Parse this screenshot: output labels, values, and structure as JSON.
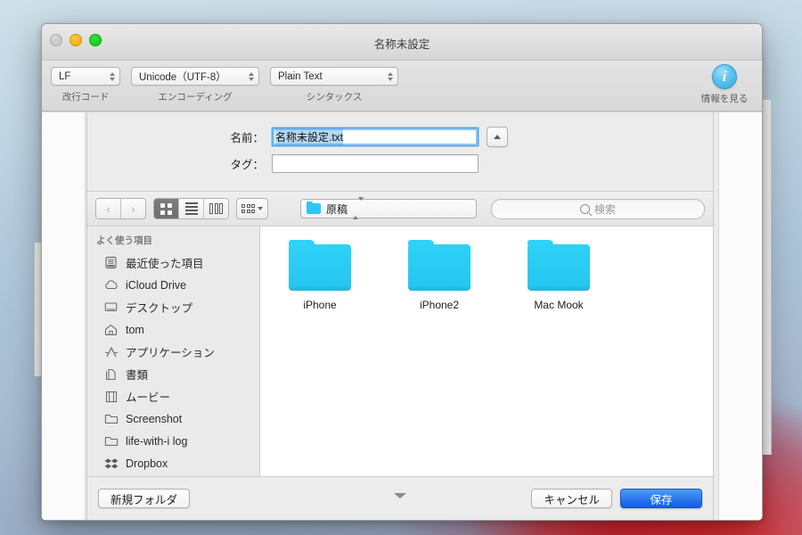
{
  "window": {
    "title": "名称未設定",
    "traffic_lights": [
      "close",
      "minimize",
      "zoom"
    ]
  },
  "toolbar": {
    "items": [
      {
        "value": "LF",
        "label": "改行コード",
        "name": "line-endings"
      },
      {
        "value": "Unicode（UTF-8）",
        "label": "エンコーディング",
        "name": "encoding"
      },
      {
        "value": "Plain Text",
        "label": "シンタックス",
        "name": "syntax"
      }
    ],
    "info_button": {
      "glyph": "i",
      "label": "情報を見る"
    }
  },
  "save_panel": {
    "name_label": "名前：",
    "name_value": "名称未設定.txt",
    "tag_label": "タグ：",
    "tag_value": "",
    "tag_placeholder": "",
    "disclosure_icon": "chevron-up-icon"
  },
  "navbar": {
    "back_icon": "chevron-left-icon",
    "forward_icon": "chevron-right-icon",
    "view_modes": [
      {
        "name": "icon-view",
        "icon": "grid-icon",
        "active": true
      },
      {
        "name": "list-view",
        "icon": "list-icon",
        "active": false
      },
      {
        "name": "column-view",
        "icon": "columns-icon",
        "active": false
      }
    ],
    "arrange_icon": "arrange-grid-icon",
    "location": {
      "name": "原稿",
      "icon": "folder-icon"
    },
    "search_placeholder": "検索",
    "search_icon": "search-icon"
  },
  "sidebar": {
    "header": "よく使う項目",
    "items": [
      {
        "label": "最近使った項目",
        "icon": "recents-icon"
      },
      {
        "label": "iCloud Drive",
        "icon": "cloud-icon"
      },
      {
        "label": "デスクトップ",
        "icon": "desktop-icon"
      },
      {
        "label": "tom",
        "icon": "home-icon"
      },
      {
        "label": "アプリケーション",
        "icon": "applications-icon"
      },
      {
        "label": "書類",
        "icon": "documents-icon"
      },
      {
        "label": "ムービー",
        "icon": "movies-icon"
      },
      {
        "label": "Screenshot",
        "icon": "folder-icon"
      },
      {
        "label": "life-with-i log",
        "icon": "folder-icon"
      },
      {
        "label": "Dropbox",
        "icon": "dropbox-icon"
      }
    ]
  },
  "files": [
    {
      "name": "iPhone",
      "kind": "folder"
    },
    {
      "name": "iPhone2",
      "kind": "folder"
    },
    {
      "name": "Mac Mook",
      "kind": "folder"
    }
  ],
  "bottom_bar": {
    "new_folder": "新規フォルダ",
    "cancel": "キャンセル",
    "save": "保存",
    "resize_icon": "chevron-down-icon"
  },
  "left_dock": {
    "items": [
      {
        "name": "add-clipping-button",
        "icon": "dashed-plus-icon"
      },
      {
        "name": "window-thumbnail",
        "icon": "window-preview-icon"
      },
      {
        "name": "folder-shortcut",
        "icon": "folder-icon"
      }
    ]
  },
  "right_dock": {
    "items": [
      {
        "name": "dropbox-app",
        "icon": "folder-d-icon"
      },
      {
        "name": "display-app",
        "icon": "monitor-icon"
      },
      {
        "name": "favorites-app",
        "icon": "heart-icon"
      },
      {
        "name": "recent-folders",
        "icon": "folder-clock-icon"
      },
      {
        "name": "recent-documents",
        "icon": "document-clock-icon"
      },
      {
        "name": "finder-app",
        "icon": "finder-face-icon"
      }
    ]
  },
  "colors": {
    "folder_cyan": "#2cc8f5",
    "accent_blue": "#1059e8",
    "selection_blue": "#b4d8f3",
    "info_blue": "#5cc3ee"
  }
}
